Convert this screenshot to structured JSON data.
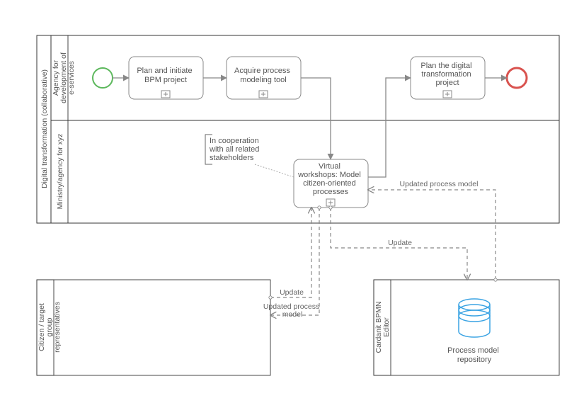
{
  "pools": {
    "main": {
      "label": "Digital transformation (collaborative)",
      "lanes": {
        "top": {
          "label": "Agency for development of e-services"
        },
        "bottom": {
          "label": "Ministry/agency for xyz"
        }
      }
    },
    "citizen": {
      "label": "Citizen / target group representatives"
    },
    "cardanit": {
      "label": "Cardanit BPMN Editor"
    }
  },
  "events": {
    "start": {
      "name": "start-event",
      "stroke": "#5cb85c"
    },
    "end": {
      "name": "end-event",
      "stroke": "#d9534f"
    }
  },
  "nodes": {
    "plan_bpm": {
      "l1": "Plan and initiate",
      "l2": "BPM project"
    },
    "acquire": {
      "l1": "Acquire process",
      "l2": "modeling tool"
    },
    "plan_dt": {
      "l1": "Plan the digital",
      "l2": "transformation",
      "l3": "project"
    },
    "workshops": {
      "l1": "Virtual",
      "l2": "workshops: Model",
      "l3": "citizen-oriented",
      "l4": "processes"
    },
    "repository": {
      "label": "Process model repository",
      "stroke": "#3aa3e3"
    }
  },
  "annotation": {
    "l1": "In cooperation",
    "l2": "with all related",
    "l3": "stakeholders"
  },
  "messages": {
    "update": "Update",
    "updatedModel": "Updated process model",
    "update2": "Update",
    "updatedModel2": "Updated process",
    "updatedModel2b": "model"
  }
}
